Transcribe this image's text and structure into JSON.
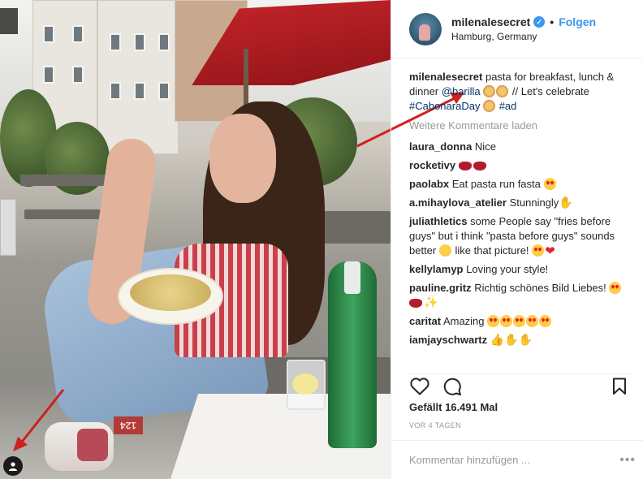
{
  "post": {
    "author": "milenalesecret",
    "follow_label": "Folgen",
    "dot": "•",
    "location": "Hamburg, Germany",
    "caption": {
      "user": "milenalesecret",
      "text_1": "pasta for breakfast, lunch & dinner",
      "mention": "@barilla",
      "text_2": "// Let's celebrate",
      "hashtag_1": "#CabonaraDay",
      "hashtag_2": "#ad"
    },
    "load_more": "Weitere Kommentare laden",
    "comments": [
      {
        "user": "laura_donna",
        "text": "Nice"
      },
      {
        "user": "rocketivy",
        "text": ""
      },
      {
        "user": "paolabx",
        "text": "Eat pasta run fasta"
      },
      {
        "user": "a.mihaylova_atelier",
        "text": "Stunningly"
      },
      {
        "user": "juliathletics",
        "text": "some People say \"fries before guys\" but i think \"pasta before guys\" sounds better",
        "text_2": "like that picture!"
      },
      {
        "user": "kellylamyp",
        "text": "Loving your style!"
      },
      {
        "user": "pauline.gritz",
        "text": "Richtig schönes Bild Liebes!"
      },
      {
        "user": "caritat",
        "text": "Amazing"
      },
      {
        "user": "iamjayschwartz",
        "text": ""
      }
    ],
    "likes": "Gefällt 16.491 Mal",
    "time": "VOR 4 TAGEN",
    "comment_placeholder": "Kommentar hinzufügen ...",
    "more_options": "•••",
    "photo_sign": "124"
  },
  "icons": {
    "verified": "verified-badge-icon",
    "like": "heart-icon",
    "comment": "comment-icon",
    "save": "bookmark-icon",
    "tag": "user-tag-icon"
  },
  "colors": {
    "link_blue": "#3897f0",
    "hashtag_blue": "#003569",
    "muted": "#999999",
    "text": "#262626",
    "arrow_red": "#d0201f"
  }
}
